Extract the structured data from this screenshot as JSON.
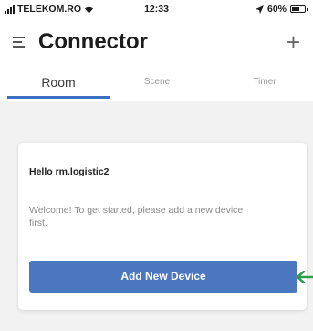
{
  "status_bar": {
    "carrier": "TELEKOM.RO",
    "time": "12:33",
    "battery": "60%",
    "battery_level": 0.6,
    "icons": [
      "signal-icon",
      "wifi-icon",
      "location-arrow-icon",
      "battery-icon"
    ]
  },
  "header": {
    "title": "Connector",
    "icons": [
      "menu-icon",
      "plus-icon"
    ]
  },
  "tabs": [
    {
      "label": "Room",
      "active": true
    },
    {
      "label": "Scene",
      "active": false
    },
    {
      "label": "Timer",
      "active": false
    }
  ],
  "card": {
    "greeting": "Hello rm.logistic2",
    "message": "Welcome! To get started, please add a new device first.",
    "button_label": "Add New Device"
  },
  "colors": {
    "accent": "#4b76c0",
    "tab_underline": "#3d6fc2",
    "annotation_arrow": "#2e9e4a",
    "background": "#f2f2f2"
  }
}
